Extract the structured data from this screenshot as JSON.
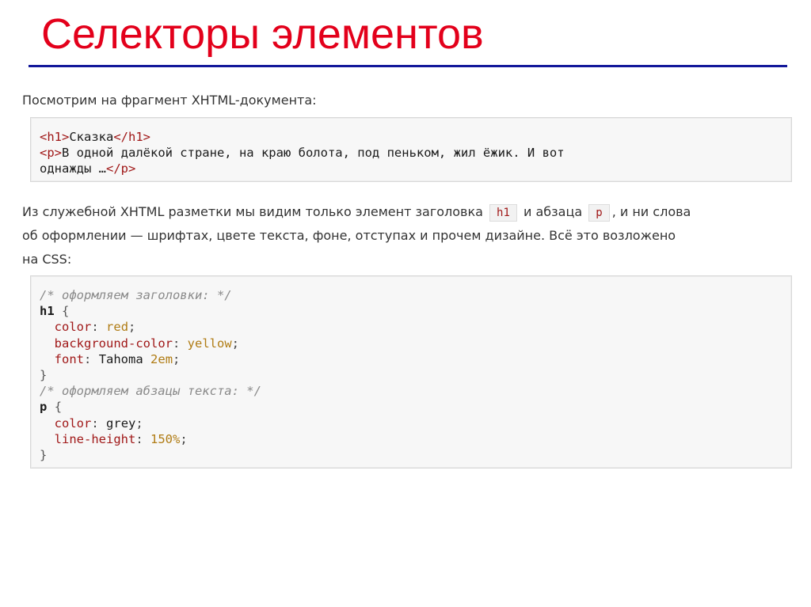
{
  "slide": {
    "title": "Селекторы элементов"
  },
  "intro": {
    "text": "Посмотрим на фрагмент XHTML-документа:"
  },
  "html_example": {
    "line1_open": "<h1>",
    "line1_text": "Сказка",
    "line1_close": "</h1>",
    "line2_open": "<p>",
    "line2_text": "В одной далёкой стране, на краю болота, под пеньком, жил ёжик. И вот",
    "line3_text": "однажды …",
    "line3_close": "</p>"
  },
  "explanation": {
    "part1": "Из служебной XHTML разметки мы видим только элемент заголовка",
    "code1": "h1",
    "part2": "и абзаца",
    "code2": "p",
    "part3": ", и ни слова",
    "line2": "об оформлении — шрифтах, цвете текста, фоне, отступах и прочем дизайне. Всё это возложено",
    "line3": "на CSS:"
  },
  "css_example": {
    "comment1": "/* оформляем заголовки: */",
    "sel1": "h1",
    "open1": "{",
    "r1_prop": "color",
    "r1_val": "red",
    "r2_prop": "background-color",
    "r2_val": "yellow",
    "r3_prop": "font",
    "r3_val_a": "Tahoma",
    "r3_val_b": "2em",
    "close1": "}",
    "comment2": "/* оформляем абзацы текста: */",
    "sel2": "p",
    "open2": "{",
    "r4_prop": "color",
    "r4_val": "grey",
    "r5_prop": "line-height",
    "r5_val": "150%",
    "close2": "}",
    "colon": ":",
    "semicolon": ";"
  },
  "colors": {
    "title": "#e3001b",
    "rule": "#13189a",
    "tag": "#a01818",
    "value": "#b07c14",
    "comment": "#8a8a8a"
  }
}
